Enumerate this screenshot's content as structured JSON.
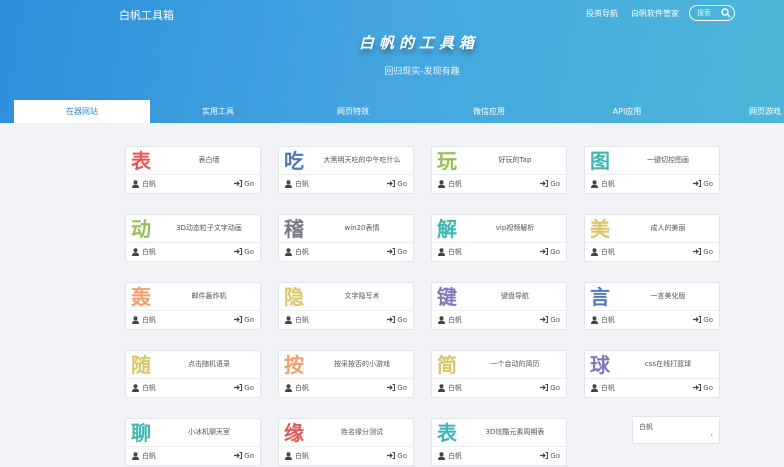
{
  "header": {
    "brand": "白帆工具箱",
    "nav": [
      "投资导航",
      "白帆软件管家"
    ],
    "search_placeholder": "搜索"
  },
  "hero": {
    "title": "白帆的工具箱",
    "subtitle": "回归现实-发现有趣"
  },
  "tabs": [
    "在器网站",
    "实用工具",
    "网页特效",
    "微信应用",
    "API应用",
    "网页游戏"
  ],
  "colors": {
    "red": "#e25959",
    "blue": "#4e79b8",
    "green": "#97be5b",
    "teal": "#3fb6b2",
    "yellow": "#d8c66b",
    "gray": "#7a7a86",
    "purple": "#7f7ab8",
    "orange": "#f39f6a",
    "sky": "#4cb7d8"
  },
  "card_common": {
    "author": "白帆",
    "go": "Go"
  },
  "cards": [
    {
      "char": "表",
      "desc": "表白墙",
      "color": "#e25959"
    },
    {
      "char": "吃",
      "desc": "大黑明天吃的中午吃什么",
      "color": "#4e79b8"
    },
    {
      "char": "玩",
      "desc": "好玩的Tap",
      "color": "#97be5b"
    },
    {
      "char": "图",
      "desc": "一键切控图画",
      "color": "#3fb6b2"
    },
    {
      "char": "动",
      "desc": "3D动态粒子文字动画",
      "color": "#97be5b"
    },
    {
      "char": "稽",
      "desc": "win20表情",
      "color": "#7a7a86"
    },
    {
      "char": "解",
      "desc": "vip视频解析",
      "color": "#3fb6b2"
    },
    {
      "char": "美",
      "desc": "成人的美丽",
      "color": "#d8c66b"
    },
    {
      "char": "轰",
      "desc": "邮件轰炸机",
      "color": "#f39f6a"
    },
    {
      "char": "隐",
      "desc": "文字隐写术",
      "color": "#d8c66b"
    },
    {
      "char": "键",
      "desc": "键盘导航",
      "color": "#7f7ab8"
    },
    {
      "char": "言",
      "desc": "一言美化版",
      "color": "#4e79b8"
    },
    {
      "char": "随",
      "desc": "点击随机语录",
      "color": "#d8c66b"
    },
    {
      "char": "按",
      "desc": "按采按否的小游戏",
      "color": "#f39f6a"
    },
    {
      "char": "简",
      "desc": "一个会动的简历",
      "color": "#d8c66b"
    },
    {
      "char": "球",
      "desc": "css在线打篮球",
      "color": "#7f7ab8"
    },
    {
      "char": "聊",
      "desc": "小冰机聊天室",
      "color": "#3fb6b2"
    },
    {
      "char": "缘",
      "desc": "姓名缘分测试",
      "color": "#e25959"
    },
    {
      "char": "表",
      "desc": "3D炫酷元素周期表",
      "color": "#3fb6b2"
    }
  ],
  "extra_card": {
    "author": "白帆"
  }
}
